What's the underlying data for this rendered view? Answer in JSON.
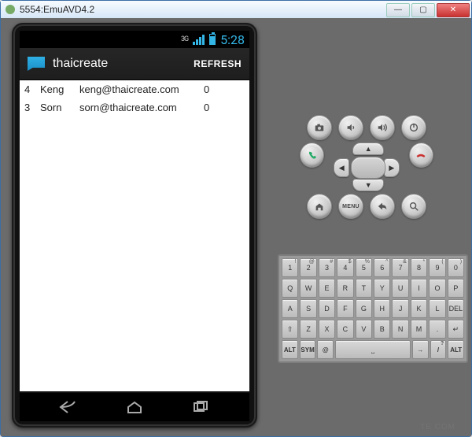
{
  "window": {
    "title": "5554:EmuAVD4.2",
    "buttons": {
      "min": "—",
      "max": "▢",
      "close": "✕"
    }
  },
  "statusbar": {
    "net": "3G",
    "clock": "5:28"
  },
  "appbar": {
    "title": "thaicreate",
    "refresh": "REFRESH"
  },
  "rows": [
    {
      "id": "4",
      "name": "Keng",
      "email": "keng@thaicreate.com",
      "count": "0"
    },
    {
      "id": "3",
      "name": "Sorn",
      "email": "sorn@thaicreate.com",
      "count": "0"
    }
  ],
  "controls": {
    "menu_label": "MENU"
  },
  "keyboard": {
    "row1": [
      {
        "m": "1",
        "s": "!"
      },
      {
        "m": "2",
        "s": "@"
      },
      {
        "m": "3",
        "s": "#"
      },
      {
        "m": "4",
        "s": "$"
      },
      {
        "m": "5",
        "s": "%"
      },
      {
        "m": "6",
        "s": "^"
      },
      {
        "m": "7",
        "s": "&"
      },
      {
        "m": "8",
        "s": "*"
      },
      {
        "m": "9",
        "s": "("
      },
      {
        "m": "0",
        "s": ")"
      }
    ],
    "row2": [
      {
        "m": "Q"
      },
      {
        "m": "W"
      },
      {
        "m": "E"
      },
      {
        "m": "R"
      },
      {
        "m": "T"
      },
      {
        "m": "Y"
      },
      {
        "m": "U"
      },
      {
        "m": "I"
      },
      {
        "m": "O"
      },
      {
        "m": "P"
      }
    ],
    "row3": [
      {
        "m": "A"
      },
      {
        "m": "S"
      },
      {
        "m": "D"
      },
      {
        "m": "F"
      },
      {
        "m": "G"
      },
      {
        "m": "H"
      },
      {
        "m": "J"
      },
      {
        "m": "K"
      },
      {
        "m": "L"
      },
      {
        "m": "DEL",
        "s": ""
      }
    ],
    "row4": [
      {
        "m": "⇧"
      },
      {
        "m": "Z"
      },
      {
        "m": "X"
      },
      {
        "m": "C"
      },
      {
        "m": "V"
      },
      {
        "m": "B"
      },
      {
        "m": "N"
      },
      {
        "m": "M"
      },
      {
        "m": "."
      },
      {
        "m": "↵"
      }
    ],
    "row5_left": [
      {
        "m": "ALT"
      },
      {
        "m": "SYM"
      },
      {
        "m": "@"
      }
    ],
    "row5_right": [
      {
        "m": "→"
      },
      {
        "m": "/",
        "s": "?"
      },
      {
        "m": "ALT"
      }
    ],
    "space": "␣"
  },
  "watermark": "TE COM"
}
